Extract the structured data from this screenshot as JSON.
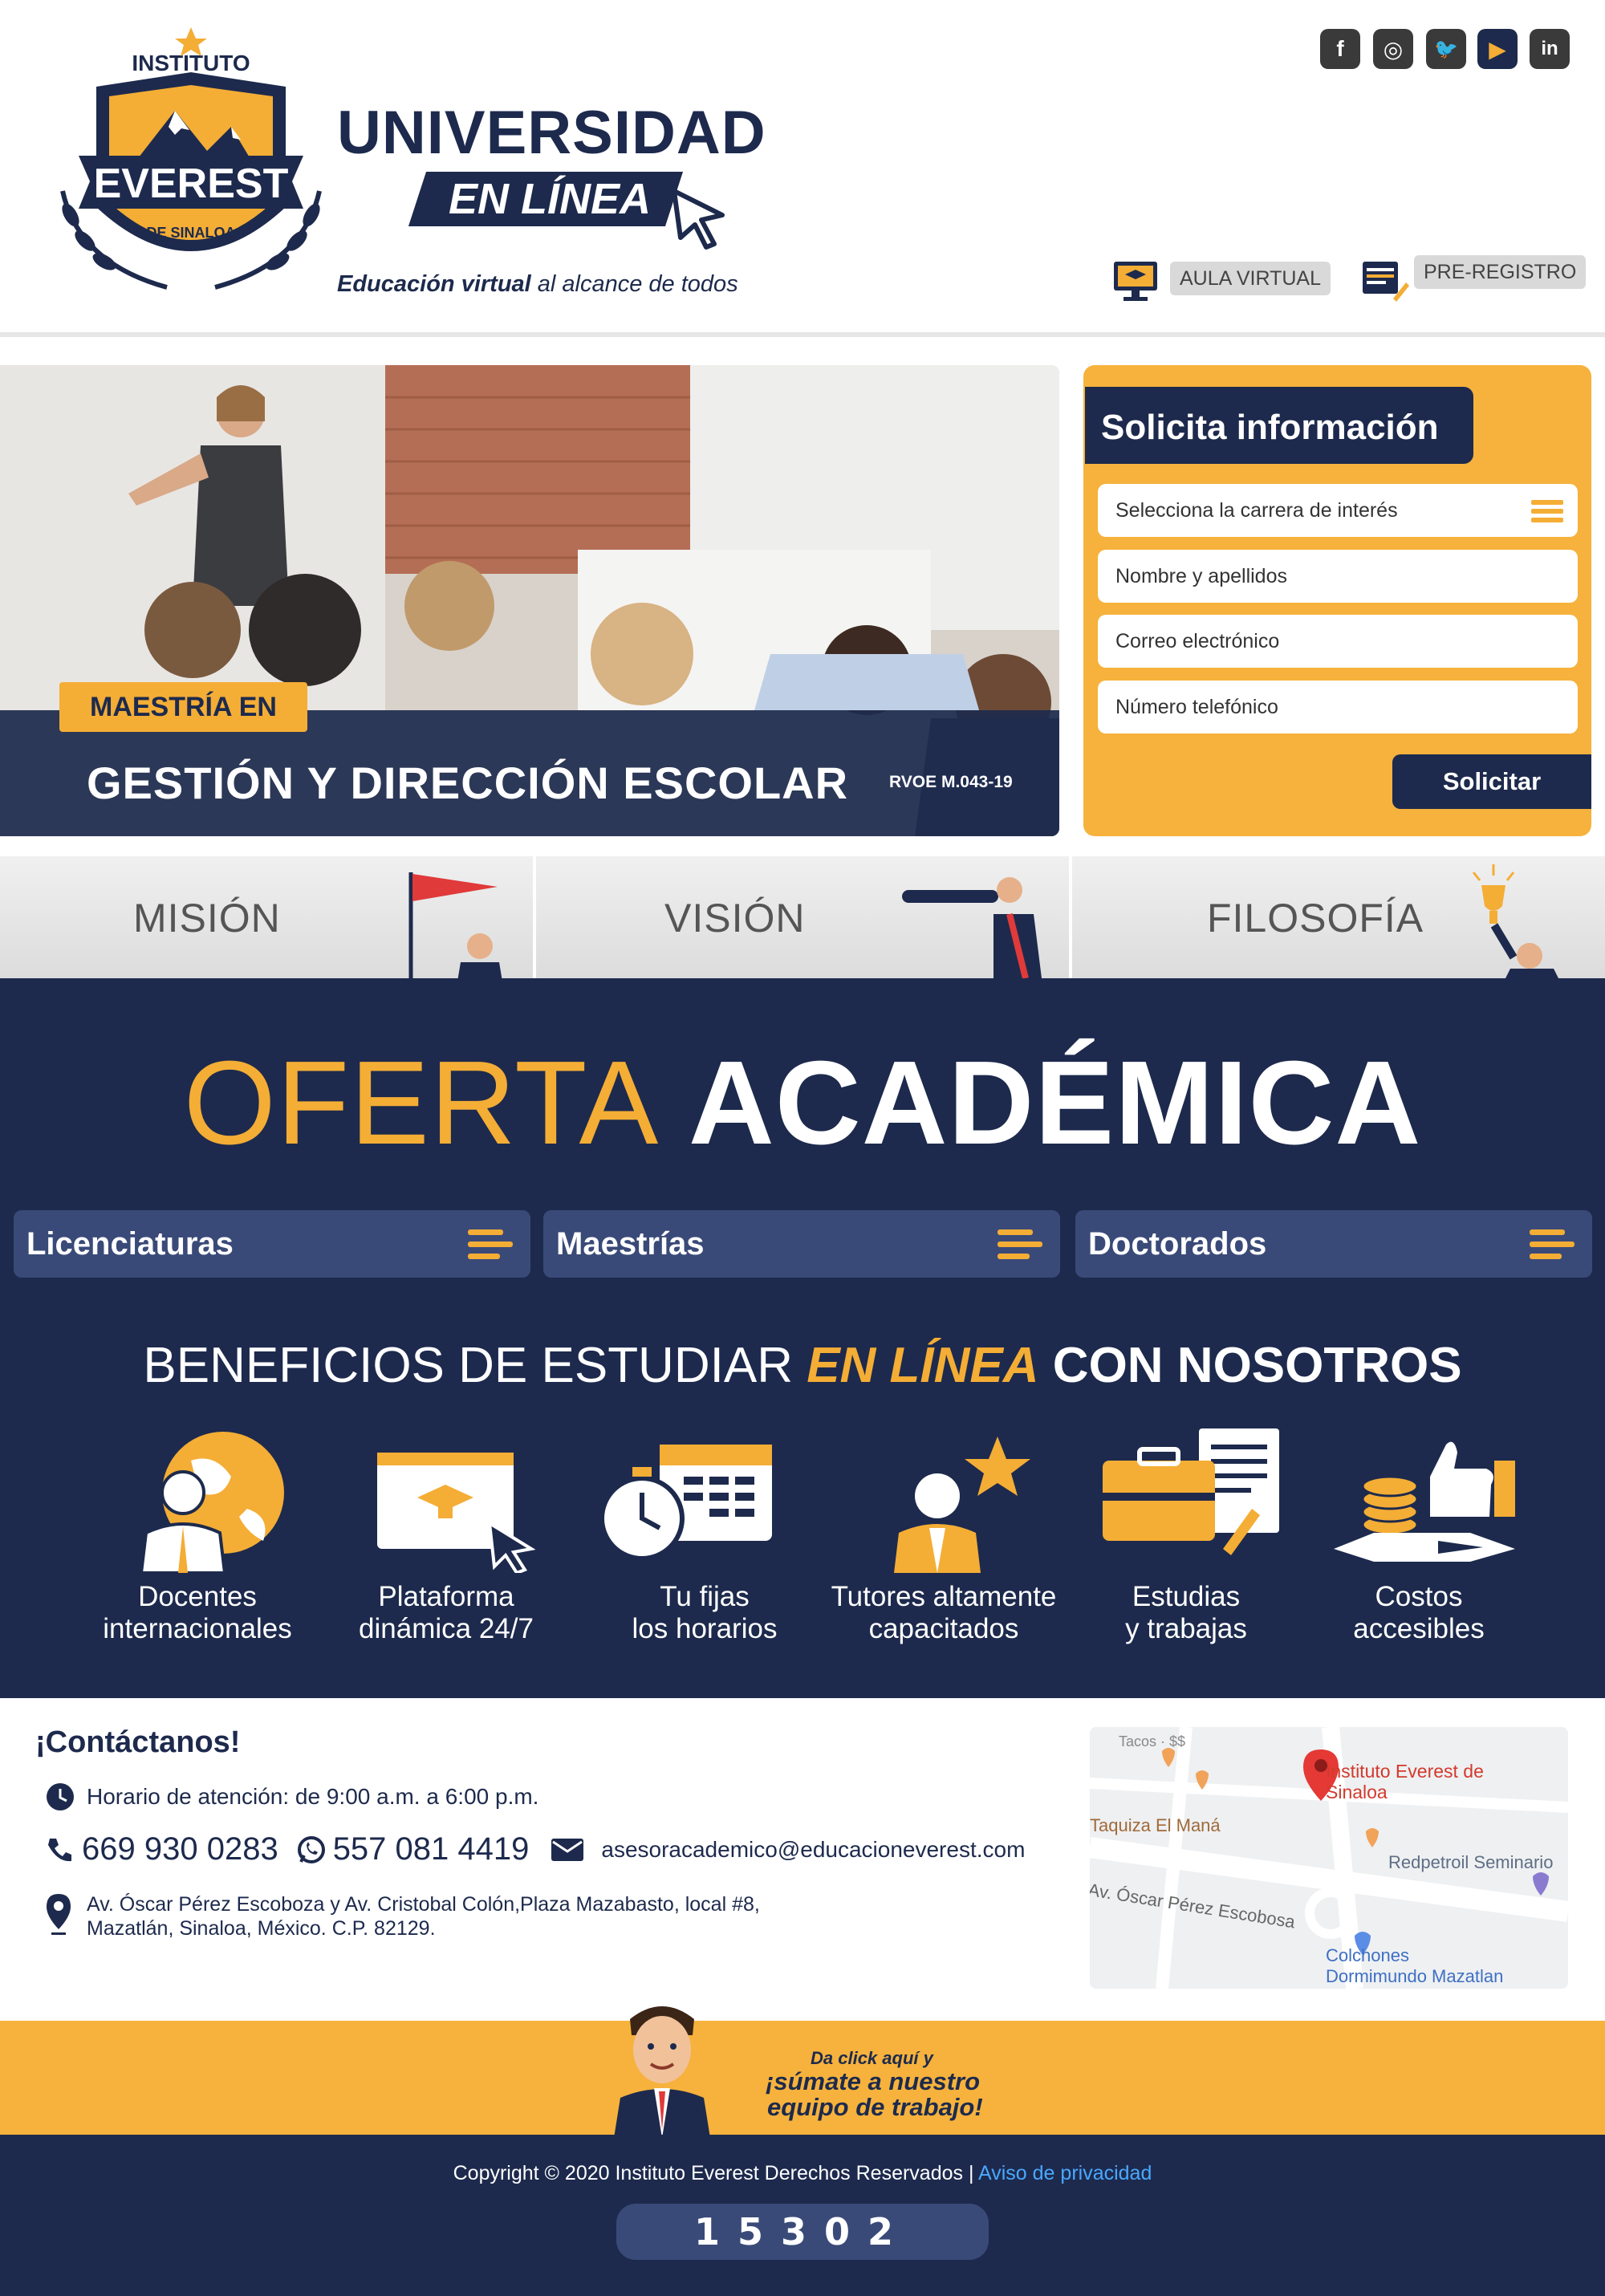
{
  "header": {
    "logo": {
      "top": "INSTITUTO",
      "main": "EVEREST",
      "bottom": "DE SINALOA"
    },
    "brand_title": "UNIVERSIDAD",
    "brand_subtitle": "EN LÍNEA",
    "tagline_bold": "Educación virtual",
    "tagline_rest": " al alcance de todos",
    "social": [
      {
        "icon": "facebook-icon",
        "glyph": "f"
      },
      {
        "icon": "instagram-icon",
        "glyph": "◎"
      },
      {
        "icon": "twitter-icon",
        "glyph": "🐦"
      },
      {
        "icon": "youtube-icon",
        "glyph": "▶"
      },
      {
        "icon": "linkedin-icon",
        "glyph": "in"
      }
    ],
    "aula_label": "AULA VIRTUAL",
    "preregistro_label": "PRE-REGISTRO"
  },
  "hero": {
    "tag": "MAESTRÍA EN",
    "title": "GESTIÓN Y DIRECCIÓN ESCOLAR",
    "rvoe": "RVOE M.043-19"
  },
  "form": {
    "title": "Solicita información",
    "career_placeholder": "Selecciona la carrera de interés",
    "name_placeholder": "Nombre y apellidos",
    "email_placeholder": "Correo electrónico",
    "phone_placeholder": "Número telefónico",
    "submit_label": "Solicitar"
  },
  "mvf": {
    "mision": "MISIÓN",
    "vision": "VISIÓN",
    "filosofia": "FILOSOFÍA"
  },
  "oferta": {
    "title_a": "OFERTA",
    "title_b": "ACADÉMICA",
    "buttons": [
      "Licenciaturas",
      "Maestrías",
      "Doctorados"
    ]
  },
  "beneficios": {
    "title_a": "BENEFICIOS DE ESTUDIAR ",
    "title_b": "EN LÍNEA",
    "title_c": " CON NOSOTROS",
    "items": [
      {
        "line1": "Docentes",
        "line2": "internacionales"
      },
      {
        "line1": "Plataforma",
        "line2": "dinámica 24/7"
      },
      {
        "line1": "Tu fijas",
        "line2": "los horarios"
      },
      {
        "line1": "Tutores altamente",
        "line2": "capacitados"
      },
      {
        "line1": "Estudias",
        "line2": "y trabajas"
      },
      {
        "line1": "Costos",
        "line2": "accesibles"
      }
    ]
  },
  "contact": {
    "title": "¡Contáctanos!",
    "hours": "Horario de atención: de 9:00 a.m. a 6:00 p.m.",
    "phone1": "669 930 0283",
    "phone2": "557 081 4419",
    "email": "asesoracademico@educacioneverest.com",
    "address1": "Av. Óscar Pérez Escoboza y Av. Cristobal Colón,Plaza Mazabasto, local #8,",
    "address2": "Mazatlán, Sinaloa, México. C.P. 82129."
  },
  "map": {
    "top_label": "Tacos · $$",
    "place": "Instituto Everest de Sinaloa",
    "poi1": "Taquiza El Maná",
    "poi2": "Redpetroil Seminario",
    "street": "Av. Óscar Pérez Escobosa",
    "poi3a": "Colchones",
    "poi3b": "Dormimundo Mazatlan"
  },
  "join": {
    "small": "Da click aquí y",
    "line1": "¡súmate a nuestro",
    "line2": "equipo de trabajo!"
  },
  "footer": {
    "copyright": "Copyright © 2020 Instituto Everest Derechos Reservados | ",
    "privacy": "Aviso de privacidad",
    "counter": "15302"
  },
  "colors": {
    "navy": "#1d2a4d",
    "accent": "#f4ad35",
    "panel": "#3a4a78"
  }
}
